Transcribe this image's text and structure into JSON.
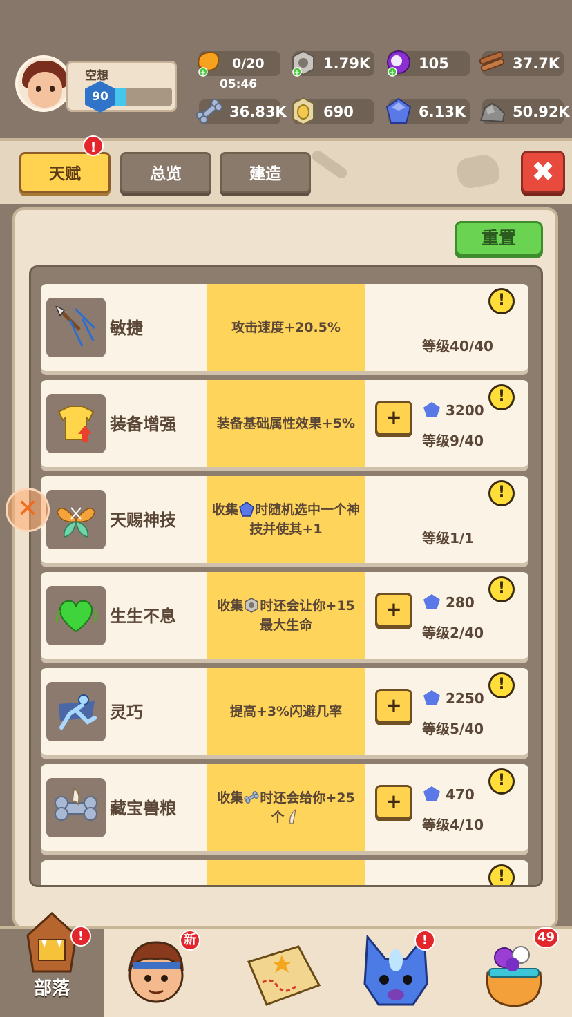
{
  "player": {
    "name": "空想",
    "level": "90",
    "xp_fraction": 0.3
  },
  "resources": {
    "energy": "0/20",
    "timer": "05:46",
    "gear": "1.79K",
    "orb": "105",
    "wood": "37.7K",
    "bone": "36.83K",
    "egg": "690",
    "gem": "6.13K",
    "stone": "50.92K"
  },
  "tabs": [
    {
      "label": "天赋",
      "active": true,
      "alert": "!"
    },
    {
      "label": "总览",
      "active": false
    },
    {
      "label": "建造",
      "active": false
    }
  ],
  "close_symbol": "✖",
  "reset_label": "重置",
  "talents": [
    {
      "name": "敏捷",
      "desc": "攻击速度+20.5%",
      "cost": "",
      "level": "等级40/40",
      "upgradable": false,
      "icon": "spear-icon"
    },
    {
      "name": "装备增强",
      "desc": "装备基础属性效果+5%",
      "cost": "3200",
      "level": "等级9/40",
      "upgradable": true,
      "icon": "armor-up-icon"
    },
    {
      "name": "天赐神技",
      "desc_pre": "收集",
      "desc_post": "时随机选中一个神技并使其+1",
      "cost": "",
      "level": "等级1/1",
      "upgradable": false,
      "icon": "wings-icon",
      "inline_icon": "gem"
    },
    {
      "name": "生生不息",
      "desc_pre": "收集",
      "desc_post": "时还会让你+15最大生命",
      "cost": "280",
      "level": "等级2/40",
      "upgradable": true,
      "icon": "heart-icon",
      "inline_icon": "gear"
    },
    {
      "name": "灵巧",
      "desc": "提高+3%闪避几率",
      "cost": "2250",
      "level": "等级5/40",
      "upgradable": true,
      "icon": "dodge-icon"
    },
    {
      "name": "藏宝兽粮",
      "desc_pre": "收集",
      "desc_post": "时还会给你+25个",
      "cost": "470",
      "level": "等级4/10",
      "upgradable": true,
      "icon": "bone-treasure-icon",
      "inline_icon": "bone",
      "trailing_icon": "claw"
    }
  ],
  "info_symbol": "!",
  "plus_symbol": "+",
  "nav": [
    {
      "label": "部落",
      "badge": "!",
      "icon": "tribe-icon",
      "active": true
    },
    {
      "label": "",
      "badge": "新",
      "icon": "hero-icon",
      "active": false
    },
    {
      "label": "",
      "badge": "",
      "icon": "map-icon",
      "active": false
    },
    {
      "label": "",
      "badge": "!",
      "icon": "pet-icon",
      "active": false
    },
    {
      "label": "",
      "badge": "49",
      "icon": "bag-icon",
      "active": false
    }
  ],
  "side_orb_symbol": "✕",
  "colors": {
    "tab_active": "#ffd24f",
    "reset_green": "#6ad452",
    "close_red": "#e84a3d",
    "desc_yellow": "#ffd45a",
    "gem_blue": "#5b79e6"
  }
}
